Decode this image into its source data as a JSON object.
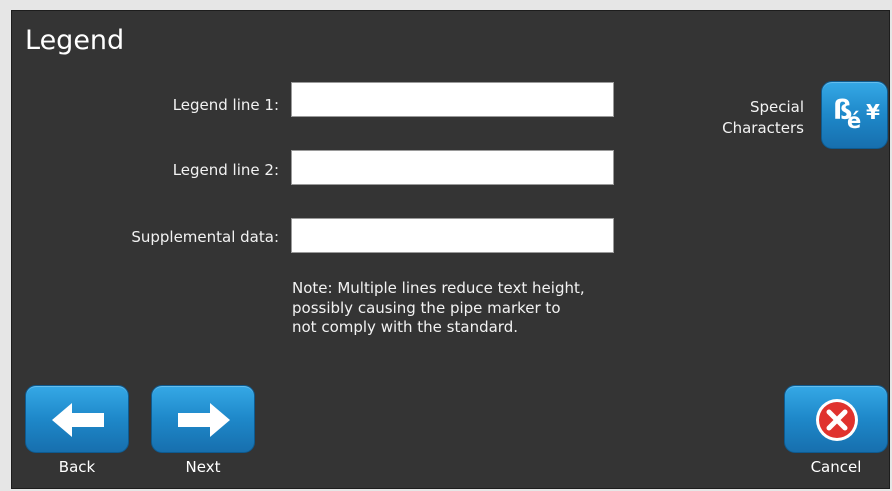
{
  "header": {
    "title": "Legend"
  },
  "form": {
    "legend_line_1": {
      "label": "Legend line 1:",
      "value": ""
    },
    "legend_line_2": {
      "label": "Legend line 2:",
      "value": ""
    },
    "supplemental": {
      "label": "Supplemental data:",
      "value": ""
    }
  },
  "note": {
    "line1": "Note: Multiple lines reduce text height,",
    "line2": "possibly causing the pipe marker to",
    "line3": "not comply with the standard."
  },
  "special_characters": {
    "label_line1": "Special",
    "label_line2": "Characters",
    "glyph_1": "ß",
    "glyph_2": "é",
    "glyph_3": "¥",
    "icon": "special-characters-icon"
  },
  "nav": {
    "back_label": "Back",
    "next_label": "Next",
    "cancel_label": "Cancel",
    "back_icon": "arrow-left-icon",
    "next_icon": "arrow-right-icon",
    "cancel_icon": "close-circle-icon"
  },
  "colors": {
    "background": "#343434",
    "button_blue": "#1e88c9",
    "cancel_red": "#e0322e",
    "text": "#ffffff"
  }
}
